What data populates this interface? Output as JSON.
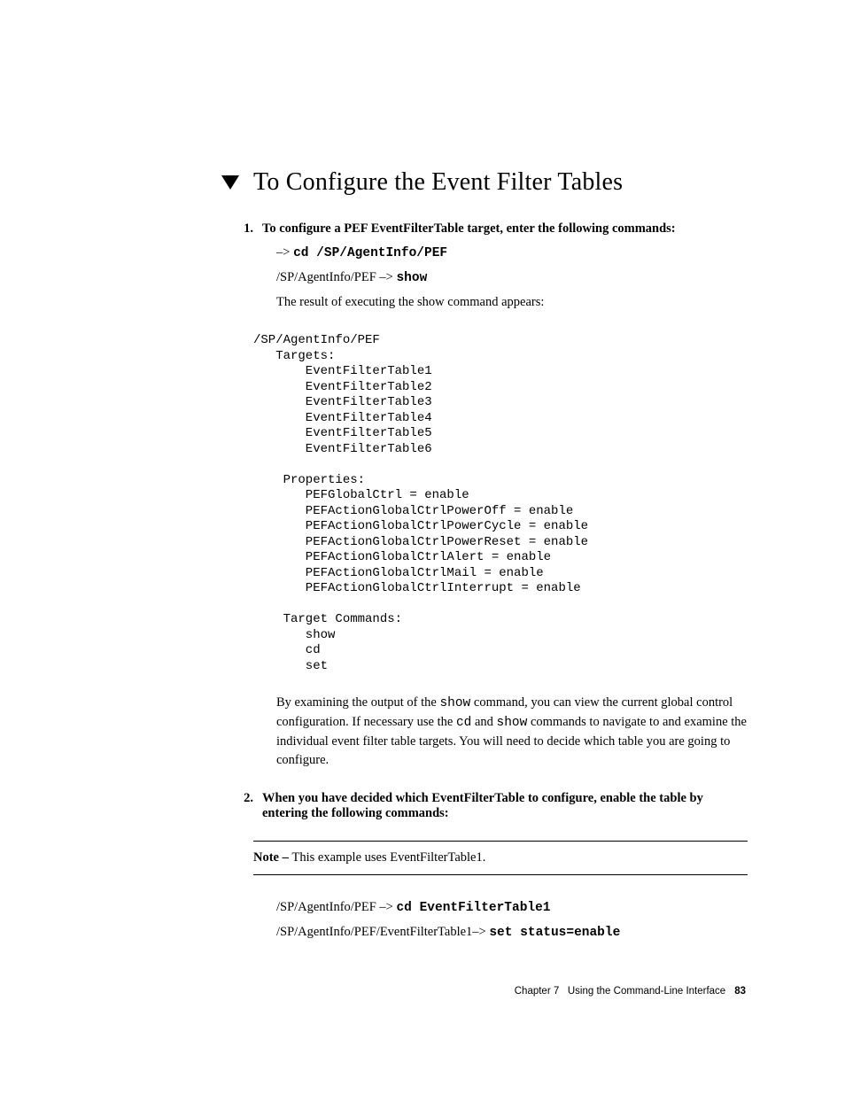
{
  "heading": "To Configure the Event Filter Tables",
  "steps": {
    "s1": {
      "num": "1.",
      "title": "To configure a PEF EventFilterTable target, enter the following commands:",
      "line1_prefix": "–> ",
      "line1_cmd": "cd /SP/AgentInfo/PEF",
      "line2_prefix": "/SP/AgentInfo/PEF –> ",
      "line2_cmd": "show",
      "result_line": "The result of executing the show command appears:"
    },
    "s2": {
      "num": "2.",
      "title": "When you have decided which EventFilterTable to configure, enable the table by entering the following commands:"
    }
  },
  "code_output": "/SP/AgentInfo/PEF\n   Targets:\n       EventFilterTable1\n       EventFilterTable2\n       EventFilterTable3\n       EventFilterTable4\n       EventFilterTable5\n       EventFilterTable6\n\n    Properties:\n       PEFGlobalCtrl = enable\n       PEFActionGlobalCtrlPowerOff = enable\n       PEFActionGlobalCtrlPowerCycle = enable\n       PEFActionGlobalCtrlPowerReset = enable\n       PEFActionGlobalCtrlAlert = enable\n       PEFActionGlobalCtrlMail = enable\n       PEFActionGlobalCtrlInterrupt = enable\n\n    Target Commands:\n       show\n       cd\n       set",
  "explain_para": {
    "t1": "By examining the output of the ",
    "c1": "show",
    "t2": " command, you can view the current global control configuration. If necessary use the ",
    "c2": "cd",
    "t3": " and ",
    "c3": "show",
    "t4": " commands to navigate to and examine the individual event filter table targets. You will need to decide which table you are going to configure."
  },
  "note": {
    "label": "Note – ",
    "text": "This example uses EventFilterTable1."
  },
  "cmds_after_note": {
    "l1_prefix": "/SP/AgentInfo/PEF –> ",
    "l1_cmd": "cd EventFilterTable1",
    "l2_prefix": "/SP/AgentInfo/PEF/EventFilterTable1–> ",
    "l2_cmd": "set status=enable"
  },
  "footer": {
    "chapter": "Chapter 7",
    "title": "Using the Command-Line Interface",
    "page": "83"
  }
}
